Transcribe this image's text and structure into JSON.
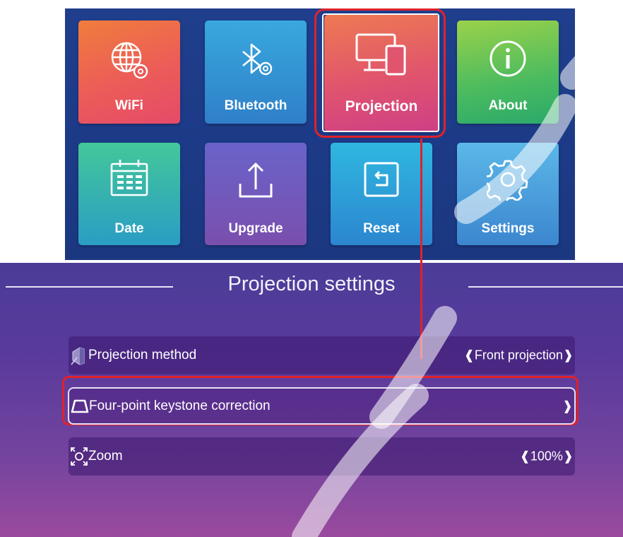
{
  "home_menu": {
    "tiles": [
      {
        "label": "WiFi",
        "icon": "wifi-globe-icon"
      },
      {
        "label": "Bluetooth",
        "icon": "bluetooth-icon"
      },
      {
        "label": "Projection",
        "icon": "projection-devices-icon"
      },
      {
        "label": "About",
        "icon": "info-icon"
      },
      {
        "label": "Date",
        "icon": "calendar-icon"
      },
      {
        "label": "Upgrade",
        "icon": "upload-icon"
      },
      {
        "label": "Reset",
        "icon": "reset-icon"
      },
      {
        "label": "Settings",
        "icon": "gear-icon"
      }
    ],
    "highlight_color": "#e0222a"
  },
  "projection_settings": {
    "title": "Projection settings",
    "rows": [
      {
        "label": "Projection method",
        "value": "Front projection",
        "icon": "projection-method-icon"
      },
      {
        "label": "Four-point keystone correction",
        "value": "",
        "icon": "keystone-icon"
      },
      {
        "label": "Zoom",
        "value": "100%",
        "icon": "zoom-icon"
      }
    ]
  },
  "colors": {
    "home_bg": "#1f3e8c",
    "panel_top": "#4b3c98",
    "panel_bottom": "#9a4a9e",
    "highlight": "#e0222a"
  }
}
